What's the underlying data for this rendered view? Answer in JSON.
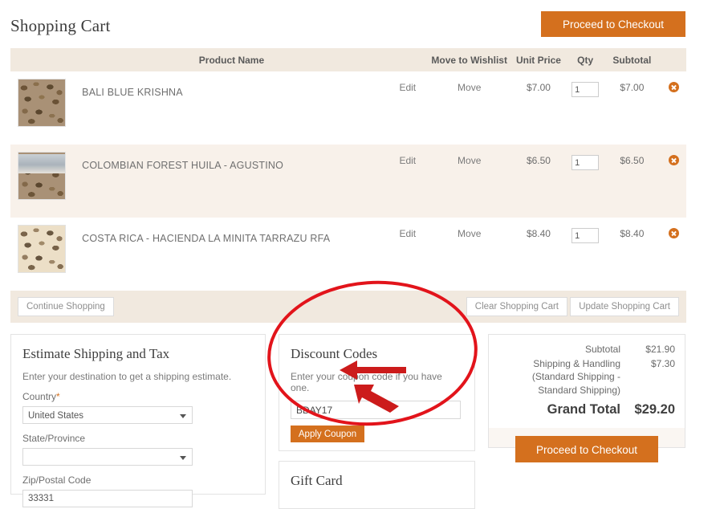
{
  "header": {
    "title": "Shopping Cart",
    "checkout_label": "Proceed to Checkout"
  },
  "cart_table": {
    "columns": {
      "thumb": "",
      "name": "Product Name",
      "edit": "",
      "wishlist": "Move to Wishlist",
      "unit_price": "Unit Price",
      "qty": "Qty",
      "subtotal": "Subtotal",
      "remove": ""
    },
    "rows": [
      {
        "name": "BALI BLUE KRISHNA",
        "edit": "Edit",
        "move": "Move",
        "unit_price": "$7.00",
        "qty": "1",
        "subtotal": "$7.00"
      },
      {
        "name": "COLOMBIAN FOREST HUILA - AGUSTINO",
        "edit": "Edit",
        "move": "Move",
        "unit_price": "$6.50",
        "qty": "1",
        "subtotal": "$6.50"
      },
      {
        "name": "COSTA RICA - HACIENDA LA MINITA TARRAZU RFA",
        "edit": "Edit",
        "move": "Move",
        "unit_price": "$8.40",
        "qty": "1",
        "subtotal": "$8.40"
      }
    ]
  },
  "cart_actions": {
    "continue_shopping": "Continue Shopping",
    "clear_cart": "Clear Shopping Cart",
    "update_cart": "Update Shopping Cart"
  },
  "shipping_panel": {
    "title": "Estimate Shipping and Tax",
    "description": "Enter your destination to get a shipping estimate.",
    "country_label": "Country",
    "country_required": "*",
    "country_value": "United States",
    "state_label": "State/Province",
    "state_value": "",
    "zip_label": "Zip/Postal Code",
    "zip_value": "33331"
  },
  "discount_panel": {
    "title": "Discount Codes",
    "description": "Enter your coupon code if you have one.",
    "coupon_value": "BDAY17",
    "coupon_placeholder": "",
    "apply_label": "Apply Coupon"
  },
  "gift_panel": {
    "title": "Gift Card"
  },
  "totals_panel": {
    "subtotal_label": "Subtotal",
    "subtotal_value": "$21.90",
    "shipping_label": "Shipping & Handling (Standard Shipping - Standard Shipping)",
    "shipping_value": "$7.30",
    "grand_total_label": "Grand Total",
    "grand_total_value": "$29.20",
    "checkout_label": "Proceed to Checkout"
  },
  "annotations": {
    "highlight_color": "#e2141b",
    "circle_target": "discount-codes-panel",
    "arrow_1_target": "coupon-code-input",
    "arrow_2_target": "apply-coupon-button"
  },
  "colors": {
    "accent_orange": "#d4701e",
    "header_band": "#f1e9df",
    "row_alt": "#f8f1ea",
    "annotation_red": "#e2141b"
  }
}
